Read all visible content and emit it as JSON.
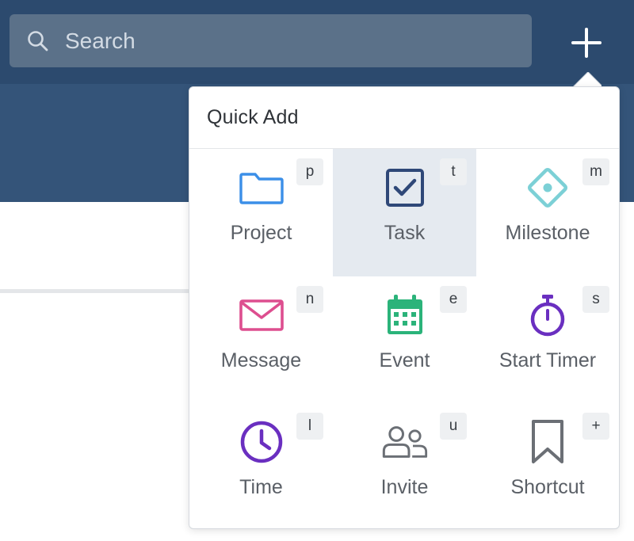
{
  "search": {
    "placeholder": "Search",
    "value": ""
  },
  "add_button": {
    "icon": "plus-icon"
  },
  "quick_add": {
    "title": "Quick Add",
    "items": [
      {
        "label": "Project",
        "shortcut": "p",
        "icon": "folder-icon",
        "color": "#3b8fe8",
        "selected": false
      },
      {
        "label": "Task",
        "shortcut": "t",
        "icon": "checkbox-icon",
        "color": "#2f4878",
        "selected": true
      },
      {
        "label": "Milestone",
        "shortcut": "m",
        "icon": "milestone-diamond-icon",
        "color": "#7cd0d6",
        "selected": false
      },
      {
        "label": "Message",
        "shortcut": "n",
        "icon": "envelope-icon",
        "color": "#dd4e8f",
        "selected": false
      },
      {
        "label": "Event",
        "shortcut": "e",
        "icon": "calendar-icon",
        "color": "#2bb37a",
        "selected": false
      },
      {
        "label": "Start Timer",
        "shortcut": "s",
        "icon": "stopwatch-icon",
        "color": "#6a2fc0",
        "selected": false
      },
      {
        "label": "Time",
        "shortcut": "l",
        "icon": "clock-icon",
        "color": "#6a2fc0",
        "selected": false
      },
      {
        "label": "Invite",
        "shortcut": "u",
        "icon": "people-icon",
        "color": "#6b6f75",
        "selected": false
      },
      {
        "label": "Shortcut",
        "shortcut": "+",
        "icon": "bookmark-icon",
        "color": "#6b6f75",
        "selected": false
      }
    ]
  },
  "colors": {
    "topbar": "#2c4a6e",
    "subbar": "#345479",
    "search_bg": "#5b7189",
    "selected_tile": "#e5eaf0"
  }
}
